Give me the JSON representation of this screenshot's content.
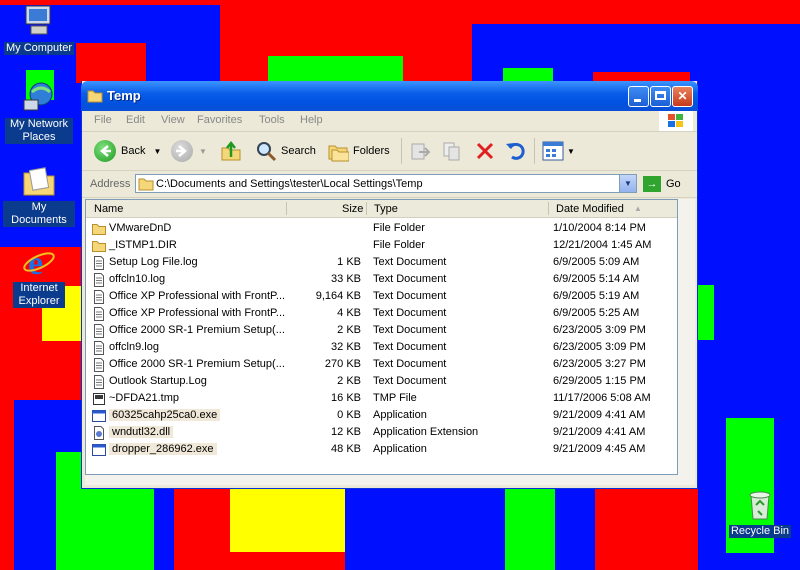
{
  "colors": {
    "red": "#ff0000",
    "blue": "#0010ff",
    "green": "#00ff00",
    "yellow": "#ffff00",
    "title_blue": "#0053e1"
  },
  "desktop": {
    "icons": [
      {
        "label": "My Computer",
        "icon": "computer-icon"
      },
      {
        "label": "My Network Places",
        "icon": "network-icon"
      },
      {
        "label": "My Documents",
        "icon": "documents-folder-icon"
      },
      {
        "label": "Internet Explorer",
        "icon": "ie-icon"
      },
      {
        "label": "Recycle Bin",
        "icon": "recycle-bin-icon"
      }
    ]
  },
  "window": {
    "title": "Temp",
    "menu": [
      "File",
      "Edit",
      "View",
      "Favorites",
      "Tools",
      "Help"
    ],
    "toolbar": {
      "back": "Back",
      "search": "Search",
      "folders": "Folders"
    },
    "address": {
      "label": "Address",
      "value": "C:\\Documents and Settings\\tester\\Local Settings\\Temp",
      "go": "Go"
    },
    "columns": {
      "name": "Name",
      "size": "Size",
      "type": "Type",
      "date": "Date Modified"
    },
    "files": [
      {
        "name": "VMwareDnD",
        "size": "",
        "type": "File Folder",
        "date": "1/10/2004 8:14 PM",
        "icon": "folder"
      },
      {
        "name": "_ISTMP1.DIR",
        "size": "",
        "type": "File Folder",
        "date": "12/21/2004 1:45 AM",
        "icon": "folder"
      },
      {
        "name": "Setup Log File.log",
        "size": "1 KB",
        "type": "Text Document",
        "date": "6/9/2005 5:09 AM",
        "icon": "text"
      },
      {
        "name": "offcln10.log",
        "size": "33 KB",
        "type": "Text Document",
        "date": "6/9/2005 5:14 AM",
        "icon": "text"
      },
      {
        "name": "Office XP Professional with FrontP...",
        "size": "9,164 KB",
        "type": "Text Document",
        "date": "6/9/2005 5:19 AM",
        "icon": "text"
      },
      {
        "name": "Office XP Professional with FrontP...",
        "size": "4 KB",
        "type": "Text Document",
        "date": "6/9/2005 5:25 AM",
        "icon": "text"
      },
      {
        "name": "Office 2000 SR-1 Premium Setup(...",
        "size": "2 KB",
        "type": "Text Document",
        "date": "6/23/2005 3:09 PM",
        "icon": "text"
      },
      {
        "name": "offcln9.log",
        "size": "32 KB",
        "type": "Text Document",
        "date": "6/23/2005 3:09 PM",
        "icon": "text"
      },
      {
        "name": "Office 2000 SR-1 Premium Setup(...",
        "size": "270 KB",
        "type": "Text Document",
        "date": "6/23/2005 3:27 PM",
        "icon": "text"
      },
      {
        "name": "Outlook Startup.Log",
        "size": "2 KB",
        "type": "Text Document",
        "date": "6/29/2005 1:15 PM",
        "icon": "text"
      },
      {
        "name": "~DFDA21.tmp",
        "size": "16 KB",
        "type": "TMP File",
        "date": "11/17/2006 5:08 AM",
        "icon": "tmp"
      },
      {
        "name": "60325cahp25ca0.exe",
        "size": "0 KB",
        "type": "Application",
        "date": "9/21/2009 4:41 AM",
        "icon": "exe"
      },
      {
        "name": "wndutl32.dll",
        "size": "12 KB",
        "type": "Application Extension",
        "date": "9/21/2009 4:41 AM",
        "icon": "dll"
      },
      {
        "name": "dropper_286962.exe",
        "size": "48 KB",
        "type": "Application",
        "date": "9/21/2009 4:45 AM",
        "icon": "exe"
      }
    ]
  }
}
